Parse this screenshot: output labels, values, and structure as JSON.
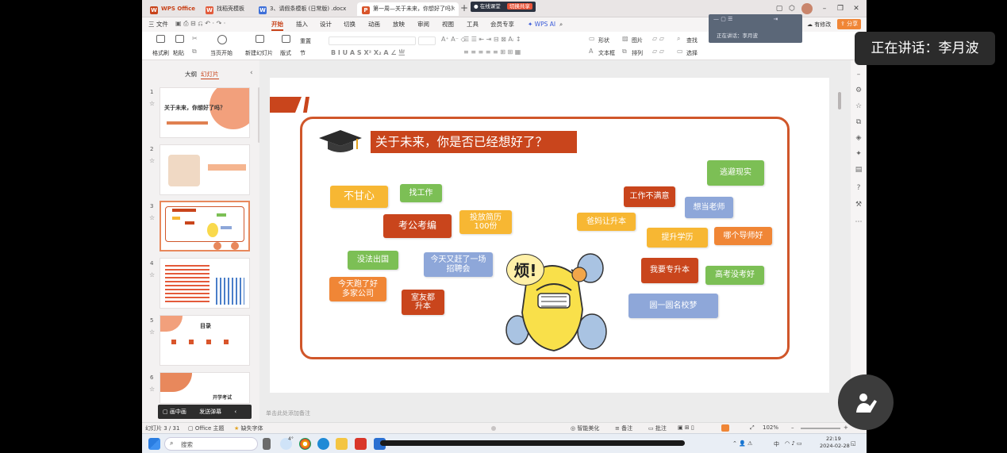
{
  "titlebar": {
    "app_name": "WPS Office",
    "tabs": [
      {
        "label": "找稻壳模板",
        "icon": "wps-icon"
      },
      {
        "label": "3、请假条模板 (日常版) .docx",
        "icon": "word-doc-icon"
      },
      {
        "label": "第一周—关于未来，你想好了吗？",
        "icon": "ppt-doc-icon",
        "active": true
      }
    ],
    "online_class_label": "在线课堂",
    "live_badge": "切换共享"
  },
  "menubar": {
    "file_label": "三 文件",
    "items": [
      "开始",
      "插入",
      "设计",
      "切换",
      "动画",
      "放映",
      "审阅",
      "视图",
      "工具",
      "会员专享"
    ],
    "active_item": "开始",
    "ai_label": "WPS AI",
    "right_items": [
      "有修改",
      "分享"
    ]
  },
  "ribbon": {
    "groups": [
      "格式刷",
      "粘贴",
      "当页开始",
      "新建幻灯片",
      "版式",
      "节",
      "重置"
    ],
    "right_groups": [
      "形状",
      "图片",
      "查找",
      "文本框",
      "排列",
      "选择"
    ]
  },
  "mini_overlay": {
    "speaking_label": "正在讲话：李月波"
  },
  "leftpane": {
    "tabs": [
      "大纲",
      "幻灯片"
    ],
    "active_tab": "幻灯片",
    "slide_numbers": [
      "1",
      "2",
      "3",
      "4",
      "5",
      "6"
    ],
    "thumb1_title": "关于未来，你想好了吗？",
    "thumb5_title": "目录",
    "thumb6_title": "开学考试",
    "bottom_buttons": [
      "画中画",
      "发送弹幕"
    ]
  },
  "slide": {
    "title": "关于未来，你是否已经想好了？",
    "burst_text": "烦!",
    "tags": [
      {
        "text": "不甘心",
        "color": "yellow"
      },
      {
        "text": "找工作",
        "color": "green"
      },
      {
        "text": "考公考编",
        "color": "red"
      },
      {
        "text": "投放简历\n100份",
        "color": "yellow"
      },
      {
        "text": "没法出国",
        "color": "green"
      },
      {
        "text": "今天又赶了一场\n招聘会",
        "color": "blue"
      },
      {
        "text": "今天跑了好\n多家公司",
        "color": "orange"
      },
      {
        "text": "室友都\n升本",
        "color": "orange"
      },
      {
        "text": "逃避现实",
        "color": "green"
      },
      {
        "text": "工作不满意",
        "color": "red"
      },
      {
        "text": "想当老师",
        "color": "blue"
      },
      {
        "text": "爸妈让升本",
        "color": "yellow"
      },
      {
        "text": "提升学历",
        "color": "yellow"
      },
      {
        "text": "哪个导师好",
        "color": "orange"
      },
      {
        "text": "我要专升本",
        "color": "red"
      },
      {
        "text": "高考没考好",
        "color": "green"
      },
      {
        "text": "圆一圆名校梦",
        "color": "blue"
      }
    ],
    "notes_placeholder": "单击此处添加备注"
  },
  "status": {
    "slide_counter": "幻灯片 3 / 31",
    "theme": "Office 主题",
    "missing_font": "缺失字体",
    "smart_beautify": "智能美化",
    "notes": "备注",
    "comments": "批注",
    "zoom": "102%"
  },
  "taskbar": {
    "search_placeholder": "搜索",
    "time": "22:19",
    "date": "2024-02-28",
    "ime": "中",
    "weather": "4°"
  },
  "overlay": {
    "speaking_now": "正在讲话：李月波"
  },
  "colors": {
    "accent": "#c8431a",
    "slide_border": "#d0562a",
    "tag_yellow": "#f7b733",
    "tag_green": "#7cbf55",
    "tag_red": "#c9451c",
    "tag_orange": "#f08636",
    "tag_blue": "#8ea7d9"
  }
}
